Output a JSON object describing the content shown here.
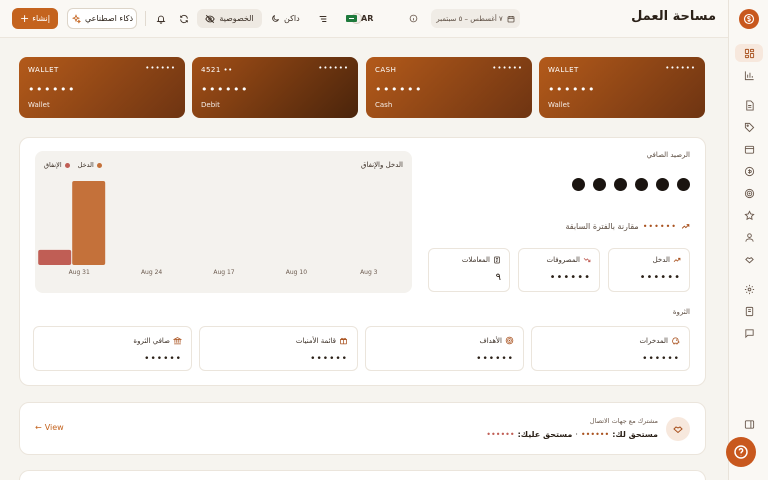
{
  "header": {
    "title": "مساحة العمل",
    "date_range": "٧ أغسطس – ٥ سبتمبر",
    "lang_label": "AR",
    "theme_label": "داكن",
    "privacy_label": "الخصوصية",
    "ai_label": "ذكاء اصطناعي",
    "create_label": "إنشاء"
  },
  "accounts": [
    {
      "label": "WALLET",
      "masked": "••••••",
      "balance": "••••••",
      "type": "Wallet",
      "color_from": "#b35a1a",
      "color_to": "#6e3412"
    },
    {
      "label": "CASH",
      "masked": "••••••",
      "balance": "••••••",
      "type": "Cash",
      "color_from": "#b35a1a",
      "color_to": "#6e3412"
    },
    {
      "label": "4521 ••",
      "masked": "••••••",
      "balance": "••••••",
      "type": "Debit",
      "color_from": "#a24f17",
      "color_to": "#4a240b"
    },
    {
      "label": "WALLET",
      "masked": "••••••",
      "balance": "••••••",
      "type": "Wallet",
      "color_from": "#b35a1a",
      "color_to": "#6e3412"
    }
  ],
  "overview": {
    "net_label": "الرصيد الصافي",
    "net_value": "••••••",
    "compare_value": "••••••",
    "compare_label": "مقارنة بالفترة السابقة",
    "stats": [
      {
        "label": "الدخل",
        "value": "••••••"
      },
      {
        "label": "المصروفات",
        "value": "••••••"
      },
      {
        "label": "المعاملات",
        "value": "٩"
      }
    ],
    "wealth_title": "الثروة",
    "wealth": [
      {
        "label": "المدخرات",
        "value": "••••••"
      },
      {
        "label": "الأهداف",
        "value": "••••••"
      },
      {
        "label": "قائمة الأمنيات",
        "value": "••••••"
      },
      {
        "label": "صافي الثروة",
        "value": "••••••"
      }
    ]
  },
  "chart_data": {
    "type": "bar",
    "title": "الدخل والإنفاق",
    "categories": [
      "Aug 3",
      "Aug 10",
      "Aug 17",
      "Aug 24",
      "Aug 31"
    ],
    "series": [
      {
        "name": "الدخل",
        "color": "#c4713a",
        "values": [
          0,
          0,
          0,
          0,
          100
        ]
      },
      {
        "name": "الإنفاق",
        "color": "#c05e55",
        "values": [
          0,
          0,
          0,
          0,
          18
        ]
      }
    ],
    "legend_placement": "top-left",
    "grid": false
  },
  "shared": {
    "subtitle": "مشترك مع جهات الاتصال",
    "owed_to_you_label": "مستحق لك:",
    "owed_to_you_value": "••••••",
    "owed_by_you_label": "مستحق عليك:",
    "owed_by_you_value": "••••••",
    "view_label": "View"
  },
  "colors": {
    "accent": "#c4631e",
    "brand": "#c8581e"
  }
}
